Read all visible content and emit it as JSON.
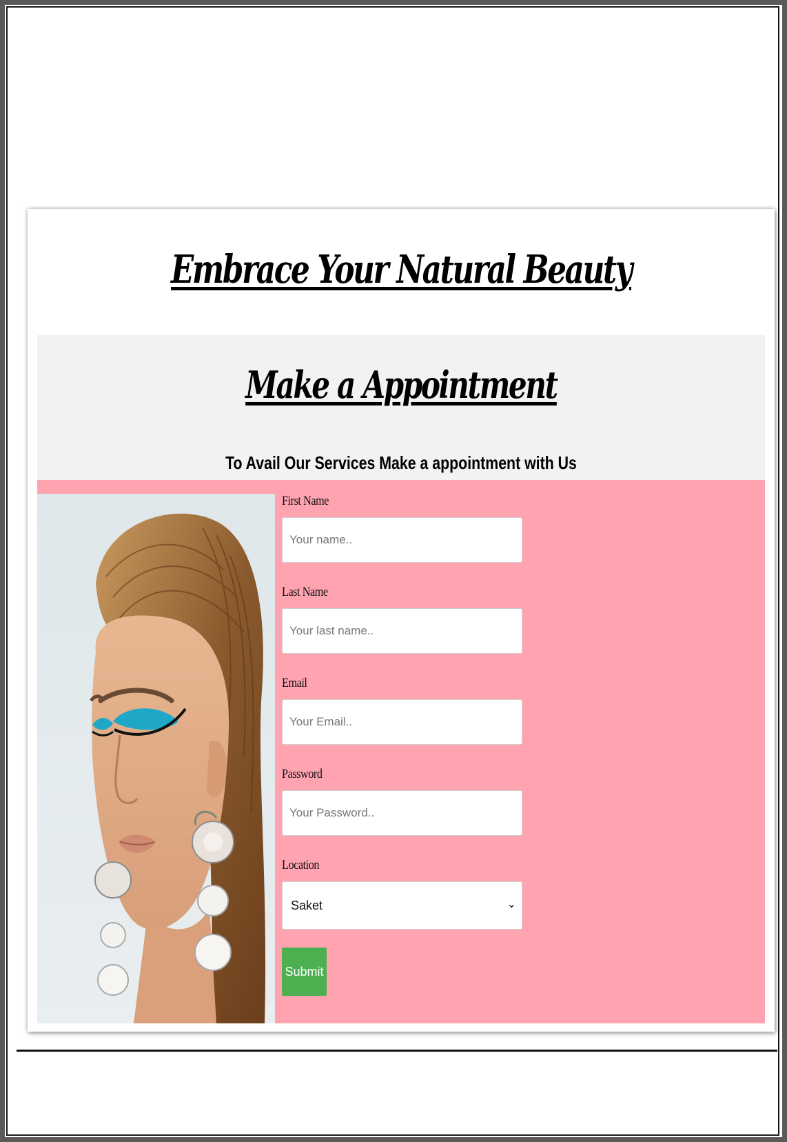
{
  "header": {
    "main_title": "Embrace Your Natural Beauty"
  },
  "appointment": {
    "title": "Make a Appointment",
    "subtitle": "To Avail Our Services Make a appointment with Us"
  },
  "form": {
    "first_name": {
      "label": "First Name",
      "placeholder": "Your name.."
    },
    "last_name": {
      "label": "Last Name",
      "placeholder": "Your last name.."
    },
    "email": {
      "label": "Email",
      "placeholder": "Your Email.."
    },
    "password": {
      "label": "Password",
      "placeholder": "Your Password.."
    },
    "location": {
      "label": "Location",
      "selected": "Saket"
    },
    "submit_label": "Submit"
  },
  "colors": {
    "pink_section": "#ffa3b1",
    "panel_gray": "#f2f2f2",
    "submit_green": "#4caf50"
  },
  "icons": {
    "select_caret": "chevron-down-icon"
  }
}
